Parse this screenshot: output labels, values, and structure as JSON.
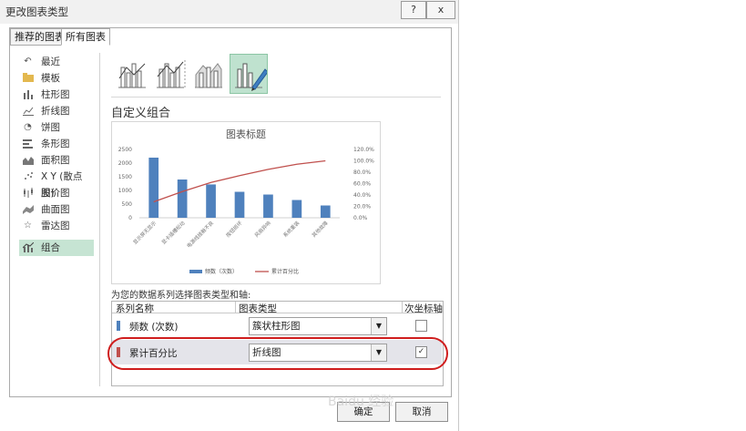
{
  "window": {
    "title": "更改图表类型",
    "help_button": "?",
    "close_button": "x"
  },
  "tabs": [
    {
      "label": "推荐的图表",
      "active": false
    },
    {
      "label": "所有图表",
      "active": true
    }
  ],
  "sidebar": {
    "items": [
      {
        "label": "最近",
        "icon": "undo-arrow-icon"
      },
      {
        "label": "模板",
        "icon": "folder-icon"
      },
      {
        "label": "柱形图",
        "icon": "column-chart-icon"
      },
      {
        "label": "折线图",
        "icon": "line-chart-icon"
      },
      {
        "label": "饼图",
        "icon": "pie-chart-icon"
      },
      {
        "label": "条形图",
        "icon": "bar-chart-icon"
      },
      {
        "label": "面积图",
        "icon": "area-chart-icon"
      },
      {
        "label": "X Y (散点图)",
        "icon": "scatter-chart-icon"
      },
      {
        "label": "股价图",
        "icon": "stock-chart-icon"
      },
      {
        "label": "曲面图",
        "icon": "surface-chart-icon"
      },
      {
        "label": "雷达图",
        "icon": "radar-chart-icon"
      },
      {
        "label": "组合",
        "icon": "combo-chart-icon",
        "selected": true
      }
    ]
  },
  "main": {
    "section_title": "自定义组合",
    "table_label": "为您的数据系列选择图表类型和轴:",
    "table_headers": {
      "name": "系列名称",
      "type": "图表类型",
      "secondary": "次坐标轴"
    },
    "rows": [
      {
        "series": "频数 (次数)",
        "chart_type": "簇状柱形图",
        "secondary_axis": false,
        "color": "#4f81bd"
      },
      {
        "series": "累计百分比",
        "chart_type": "折线图",
        "secondary_axis": true,
        "color": "#c0504d"
      }
    ]
  },
  "footer": {
    "ok_label": "确定",
    "cancel_label": "取消",
    "watermark": "Baidu 经验"
  },
  "chart_data": {
    "type": "bar",
    "title": "图表标题",
    "categories": [
      "显示屏无显示",
      "显卡插槽松动",
      "电源线接触不良",
      "按钮损坏",
      "风扇异响",
      "系统重装",
      "其他故障"
    ],
    "series": [
      {
        "name": "频数（次数）",
        "type": "bar",
        "axis": "primary",
        "values": [
          2200,
          1400,
          1220,
          950,
          850,
          650,
          450
        ],
        "color": "#4f81bd"
      },
      {
        "name": "累计百分比",
        "type": "line",
        "axis": "secondary",
        "values": [
          28,
          46,
          62,
          74,
          85,
          94,
          100
        ],
        "color": "#c0504d"
      }
    ],
    "y_ticks": [
      "2500",
      "2000",
      "1500",
      "1000",
      "500",
      "0"
    ],
    "ylim": [
      0,
      2500
    ],
    "y2_ticks": [
      "120.0%",
      "100.0%",
      "80.0%",
      "60.0%",
      "40.0%",
      "20.0%",
      "0.0%"
    ],
    "y2lim": [
      0,
      120
    ],
    "legend": "bottom",
    "grid": false
  }
}
